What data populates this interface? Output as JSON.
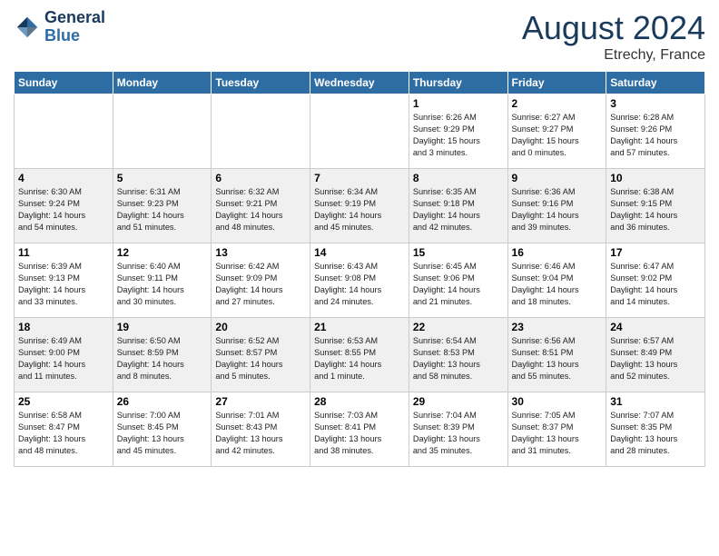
{
  "header": {
    "logo_line1": "General",
    "logo_line2": "Blue",
    "month_title": "August 2024",
    "location": "Etrechy, France"
  },
  "weekdays": [
    "Sunday",
    "Monday",
    "Tuesday",
    "Wednesday",
    "Thursday",
    "Friday",
    "Saturday"
  ],
  "weeks": [
    [
      {
        "day": "",
        "info": ""
      },
      {
        "day": "",
        "info": ""
      },
      {
        "day": "",
        "info": ""
      },
      {
        "day": "",
        "info": ""
      },
      {
        "day": "1",
        "info": "Sunrise: 6:26 AM\nSunset: 9:29 PM\nDaylight: 15 hours\nand 3 minutes."
      },
      {
        "day": "2",
        "info": "Sunrise: 6:27 AM\nSunset: 9:27 PM\nDaylight: 15 hours\nand 0 minutes."
      },
      {
        "day": "3",
        "info": "Sunrise: 6:28 AM\nSunset: 9:26 PM\nDaylight: 14 hours\nand 57 minutes."
      }
    ],
    [
      {
        "day": "4",
        "info": "Sunrise: 6:30 AM\nSunset: 9:24 PM\nDaylight: 14 hours\nand 54 minutes."
      },
      {
        "day": "5",
        "info": "Sunrise: 6:31 AM\nSunset: 9:23 PM\nDaylight: 14 hours\nand 51 minutes."
      },
      {
        "day": "6",
        "info": "Sunrise: 6:32 AM\nSunset: 9:21 PM\nDaylight: 14 hours\nand 48 minutes."
      },
      {
        "day": "7",
        "info": "Sunrise: 6:34 AM\nSunset: 9:19 PM\nDaylight: 14 hours\nand 45 minutes."
      },
      {
        "day": "8",
        "info": "Sunrise: 6:35 AM\nSunset: 9:18 PM\nDaylight: 14 hours\nand 42 minutes."
      },
      {
        "day": "9",
        "info": "Sunrise: 6:36 AM\nSunset: 9:16 PM\nDaylight: 14 hours\nand 39 minutes."
      },
      {
        "day": "10",
        "info": "Sunrise: 6:38 AM\nSunset: 9:15 PM\nDaylight: 14 hours\nand 36 minutes."
      }
    ],
    [
      {
        "day": "11",
        "info": "Sunrise: 6:39 AM\nSunset: 9:13 PM\nDaylight: 14 hours\nand 33 minutes."
      },
      {
        "day": "12",
        "info": "Sunrise: 6:40 AM\nSunset: 9:11 PM\nDaylight: 14 hours\nand 30 minutes."
      },
      {
        "day": "13",
        "info": "Sunrise: 6:42 AM\nSunset: 9:09 PM\nDaylight: 14 hours\nand 27 minutes."
      },
      {
        "day": "14",
        "info": "Sunrise: 6:43 AM\nSunset: 9:08 PM\nDaylight: 14 hours\nand 24 minutes."
      },
      {
        "day": "15",
        "info": "Sunrise: 6:45 AM\nSunset: 9:06 PM\nDaylight: 14 hours\nand 21 minutes."
      },
      {
        "day": "16",
        "info": "Sunrise: 6:46 AM\nSunset: 9:04 PM\nDaylight: 14 hours\nand 18 minutes."
      },
      {
        "day": "17",
        "info": "Sunrise: 6:47 AM\nSunset: 9:02 PM\nDaylight: 14 hours\nand 14 minutes."
      }
    ],
    [
      {
        "day": "18",
        "info": "Sunrise: 6:49 AM\nSunset: 9:00 PM\nDaylight: 14 hours\nand 11 minutes."
      },
      {
        "day": "19",
        "info": "Sunrise: 6:50 AM\nSunset: 8:59 PM\nDaylight: 14 hours\nand 8 minutes."
      },
      {
        "day": "20",
        "info": "Sunrise: 6:52 AM\nSunset: 8:57 PM\nDaylight: 14 hours\nand 5 minutes."
      },
      {
        "day": "21",
        "info": "Sunrise: 6:53 AM\nSunset: 8:55 PM\nDaylight: 14 hours\nand 1 minute."
      },
      {
        "day": "22",
        "info": "Sunrise: 6:54 AM\nSunset: 8:53 PM\nDaylight: 13 hours\nand 58 minutes."
      },
      {
        "day": "23",
        "info": "Sunrise: 6:56 AM\nSunset: 8:51 PM\nDaylight: 13 hours\nand 55 minutes."
      },
      {
        "day": "24",
        "info": "Sunrise: 6:57 AM\nSunset: 8:49 PM\nDaylight: 13 hours\nand 52 minutes."
      }
    ],
    [
      {
        "day": "25",
        "info": "Sunrise: 6:58 AM\nSunset: 8:47 PM\nDaylight: 13 hours\nand 48 minutes."
      },
      {
        "day": "26",
        "info": "Sunrise: 7:00 AM\nSunset: 8:45 PM\nDaylight: 13 hours\nand 45 minutes."
      },
      {
        "day": "27",
        "info": "Sunrise: 7:01 AM\nSunset: 8:43 PM\nDaylight: 13 hours\nand 42 minutes."
      },
      {
        "day": "28",
        "info": "Sunrise: 7:03 AM\nSunset: 8:41 PM\nDaylight: 13 hours\nand 38 minutes."
      },
      {
        "day": "29",
        "info": "Sunrise: 7:04 AM\nSunset: 8:39 PM\nDaylight: 13 hours\nand 35 minutes."
      },
      {
        "day": "30",
        "info": "Sunrise: 7:05 AM\nSunset: 8:37 PM\nDaylight: 13 hours\nand 31 minutes."
      },
      {
        "day": "31",
        "info": "Sunrise: 7:07 AM\nSunset: 8:35 PM\nDaylight: 13 hours\nand 28 minutes."
      }
    ]
  ]
}
